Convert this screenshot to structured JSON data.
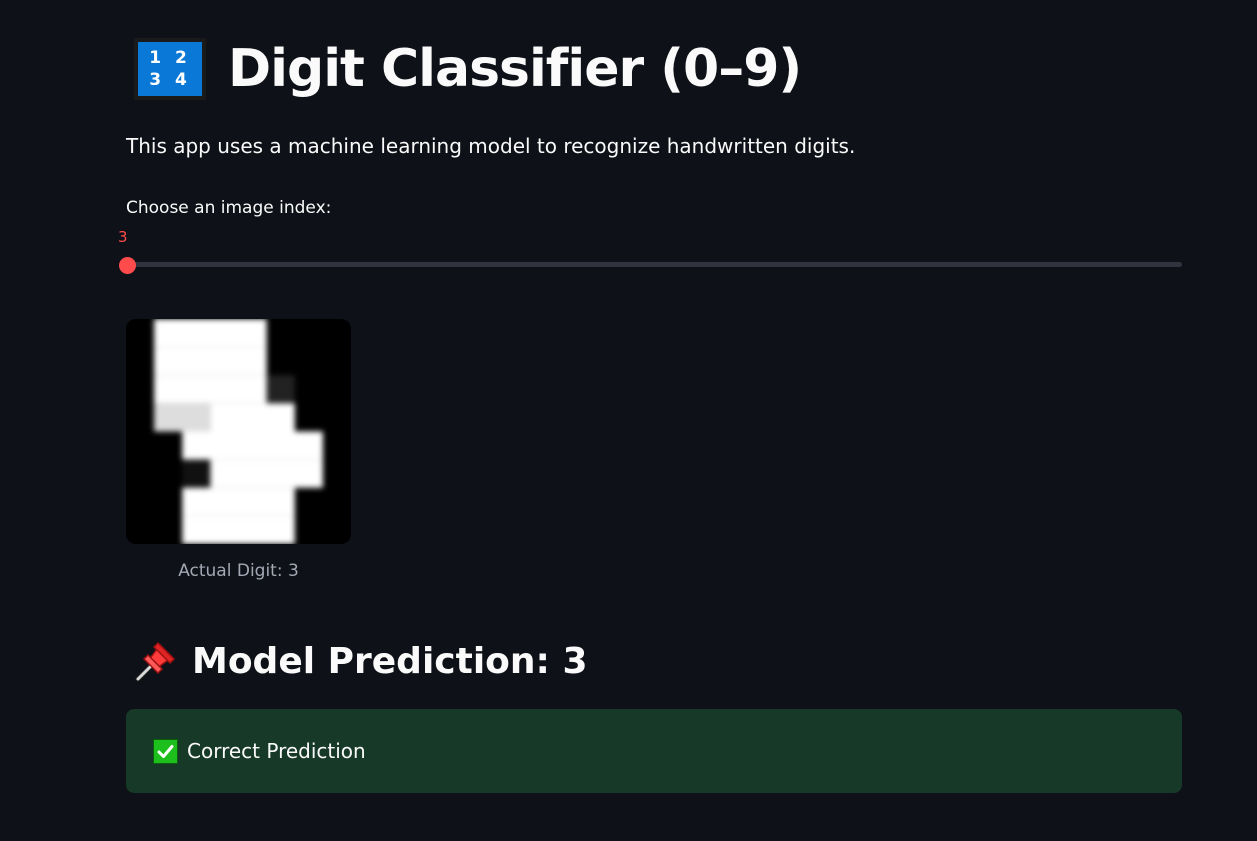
{
  "header": {
    "icon": "input-numbers-1234-icon",
    "icon_text_top": "1 2",
    "icon_text_bottom": "3 4",
    "title": "Digit Classifier (0–9)"
  },
  "description": "This app uses a machine learning model to recognize handwritten digits.",
  "slider": {
    "label": "Choose an image index:",
    "value": "3",
    "min": 0,
    "max": 1796,
    "fraction": 0.0,
    "accent_color": "#ff4b4b"
  },
  "image": {
    "caption": "Actual Digit: 3"
  },
  "prediction": {
    "icon": "pushpin-icon",
    "text": "Model Prediction: 3"
  },
  "result_alert": {
    "icon": "check-mark-icon",
    "text": "Correct Prediction",
    "color": "#173928"
  },
  "colors": {
    "background": "#0e1117",
    "text": "#fafafa"
  }
}
